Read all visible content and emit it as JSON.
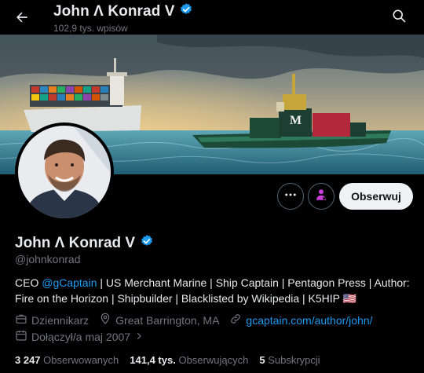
{
  "header": {
    "title": "John Λ Konrad V",
    "post_count": "102,9 tys. wpisów",
    "back_icon": "arrow-left-icon",
    "search_icon": "search-icon"
  },
  "actions": {
    "more_icon": "more-horizontal-icon",
    "subscribe_icon": "subscribe-person-icon",
    "follow_label": "Obserwuj"
  },
  "profile": {
    "name": "John Λ Konrad V",
    "handle": "@johnkonrad",
    "bio_ceo": "CEO ",
    "bio_mention": "@gCaptain",
    "bio_rest": " | US Merchant Marine | Ship Captain | Pentagon Press | Author: Fire on the Horizon | Shipbuilder | Blacklisted by Wikipedia | K5HIP 🇺🇸",
    "job": "Dziennikarz",
    "location": "Great Barrington, MA",
    "website": "gcaptain.com/author/john/",
    "joined": "Dołączył/a maj 2007"
  },
  "stats": {
    "following_count": "3 247",
    "following_label": "Obserwowanych",
    "followers_count": "141,4 tys.",
    "followers_label": "Obserwujących",
    "subscriptions_count": "5",
    "subscriptions_label": "Subskrypcji"
  },
  "colors": {
    "accent": "#1d9bf0",
    "background": "#000000",
    "follow_button": "#eff3f4",
    "muted_text": "#71767b",
    "subscribe_icon": "#c93fd7"
  }
}
